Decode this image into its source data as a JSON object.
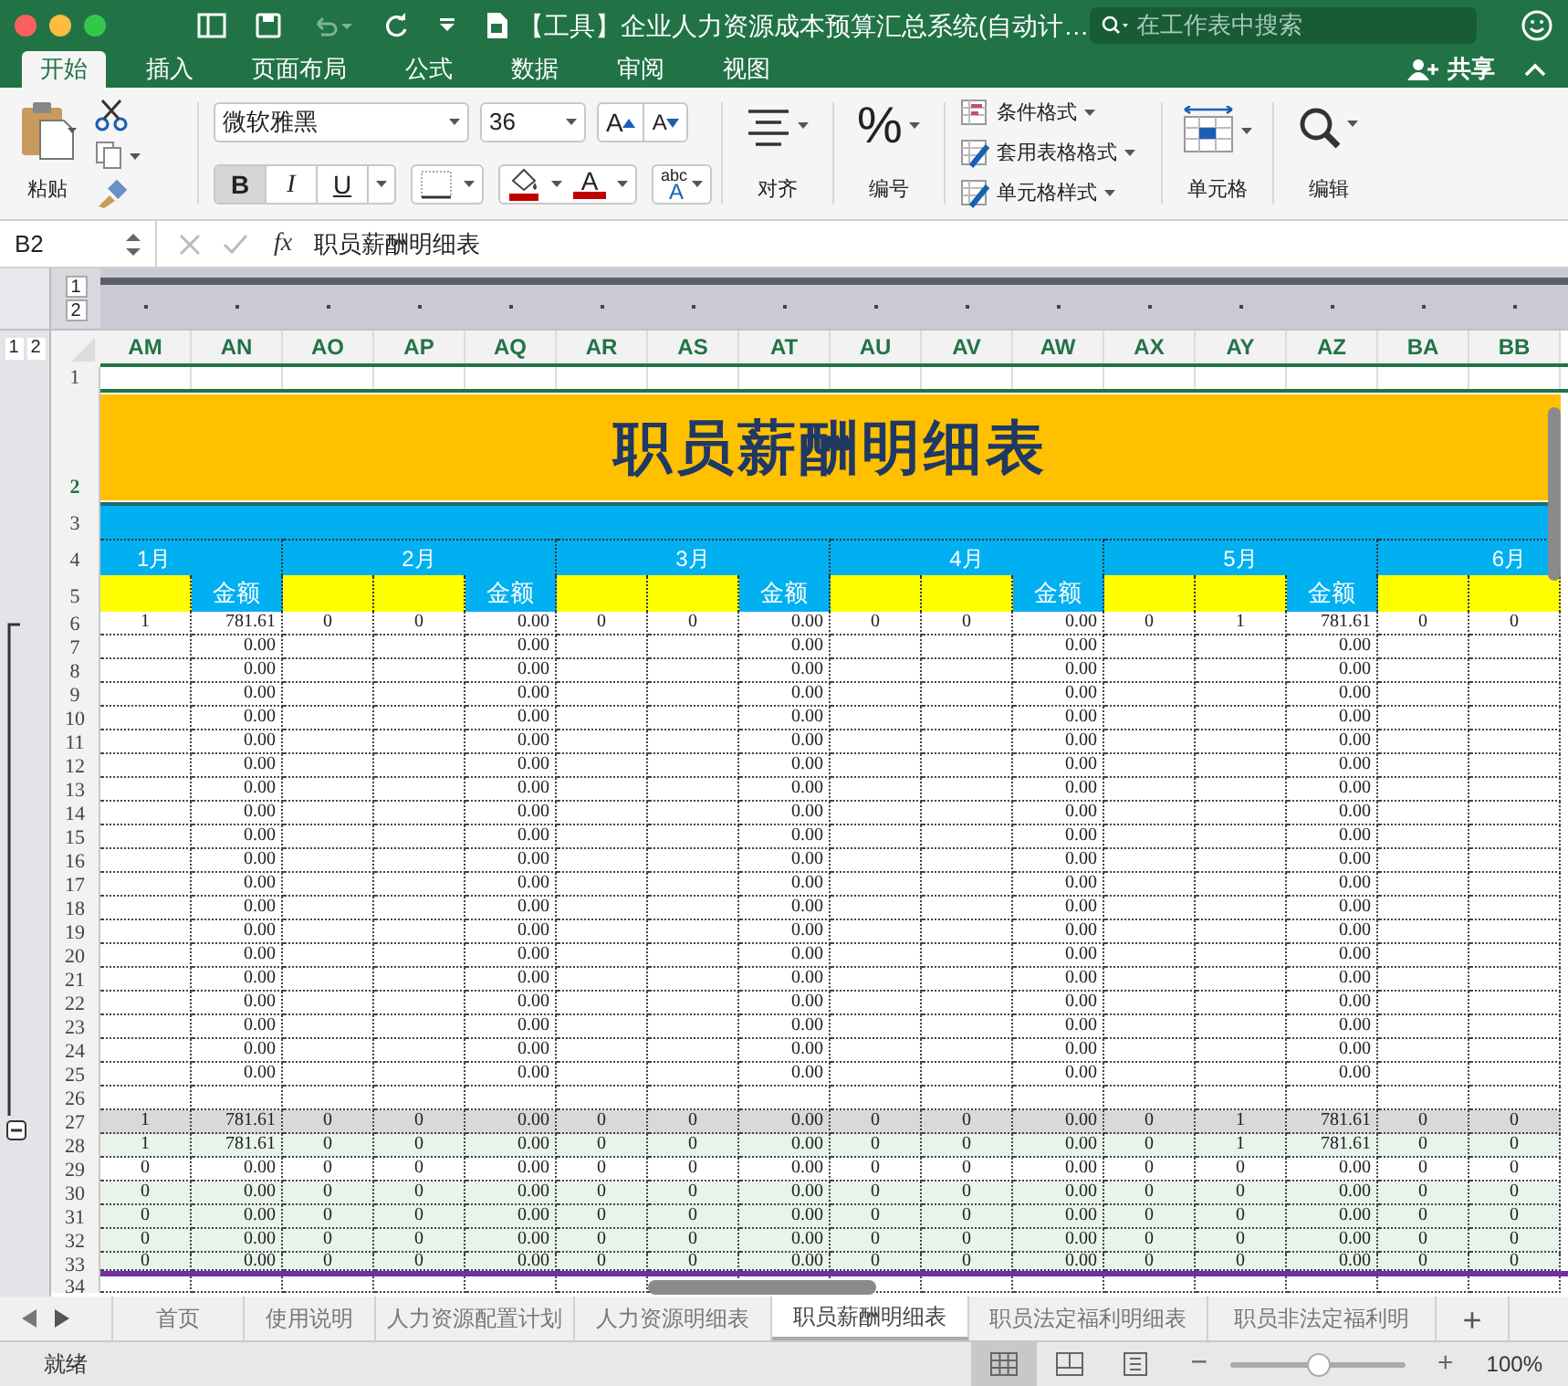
{
  "window": {
    "title": "【工具】企业人力资源成本预算汇总系统(自动计…",
    "search_placeholder": "在工作表中搜索"
  },
  "ribbon_tabs": [
    {
      "label": "开始",
      "selected": true
    },
    {
      "label": "插入",
      "selected": false
    },
    {
      "label": "页面布局",
      "selected": false
    },
    {
      "label": "公式",
      "selected": false
    },
    {
      "label": "数据",
      "selected": false
    },
    {
      "label": "审阅",
      "selected": false
    },
    {
      "label": "视图",
      "selected": false
    }
  ],
  "share": "共享",
  "ribbon": {
    "paste": "粘贴",
    "font_name": "微软雅黑",
    "font_size": "36",
    "grow_font": "A",
    "shrink_font": "A",
    "format_buttons": [
      {
        "label": "B",
        "pressed": true
      },
      {
        "label": "I",
        "pressed": false
      },
      {
        "label": "U",
        "pressed": false
      }
    ],
    "font_color": "A",
    "phonetic": "abc",
    "phonetic_mark": "A",
    "alignment": "对齐",
    "number_symbol": "%",
    "number": "编号",
    "styles": [
      "条件格式",
      "套用表格格式",
      "单元格样式"
    ],
    "cells": "单元格",
    "editing": "编辑"
  },
  "formula_bar": {
    "name_box": "B2",
    "fx": "fx",
    "formula": "职员薪酬明细表"
  },
  "column_outline_levels": [
    "1",
    "2"
  ],
  "row_outline_levels": [
    "1",
    "2"
  ],
  "columns": [
    "AM",
    "AN",
    "AO",
    "AP",
    "AQ",
    "AR",
    "AS",
    "AT",
    "AU",
    "AV",
    "AW",
    "AX",
    "AY",
    "AZ",
    "BA",
    "BB"
  ],
  "title_row": {
    "number": "2",
    "title": "职员薪酬明细表"
  },
  "months": [
    "1月",
    "2月",
    "3月",
    "4月",
    "5月",
    "6月"
  ],
  "subheaders": [
    {
      "kind": "blank"
    },
    {
      "kind": "label",
      "text": "金额"
    },
    {
      "kind": "blank"
    },
    {
      "kind": "blank"
    },
    {
      "kind": "label",
      "text": "金额"
    },
    {
      "kind": "blank"
    },
    {
      "kind": "blank"
    },
    {
      "kind": "label",
      "text": "金额"
    },
    {
      "kind": "blank"
    },
    {
      "kind": "blank"
    },
    {
      "kind": "label",
      "text": "金额"
    },
    {
      "kind": "blank"
    },
    {
      "kind": "blank"
    },
    {
      "kind": "label",
      "text": "金额"
    },
    {
      "kind": "blank"
    },
    {
      "kind": "blank"
    }
  ],
  "rows": [
    {
      "number": "6",
      "kind": "plain",
      "cells": [
        "1",
        "781.61",
        "0",
        "0",
        "0.00",
        "0",
        "0",
        "0.00",
        "0",
        "0",
        "0.00",
        "0",
        "1",
        "781.61",
        "0",
        "0"
      ]
    },
    {
      "number": "7",
      "kind": "plain",
      "cells": [
        null,
        "0.00",
        null,
        null,
        "0.00",
        null,
        null,
        "0.00",
        null,
        null,
        "0.00",
        null,
        null,
        "0.00",
        null,
        null
      ]
    },
    {
      "number": "8",
      "kind": "plain",
      "cells": [
        null,
        "0.00",
        null,
        null,
        "0.00",
        null,
        null,
        "0.00",
        null,
        null,
        "0.00",
        null,
        null,
        "0.00",
        null,
        null
      ]
    },
    {
      "number": "9",
      "kind": "plain",
      "cells": [
        null,
        "0.00",
        null,
        null,
        "0.00",
        null,
        null,
        "0.00",
        null,
        null,
        "0.00",
        null,
        null,
        "0.00",
        null,
        null
      ]
    },
    {
      "number": "10",
      "kind": "plain",
      "cells": [
        null,
        "0.00",
        null,
        null,
        "0.00",
        null,
        null,
        "0.00",
        null,
        null,
        "0.00",
        null,
        null,
        "0.00",
        null,
        null
      ]
    },
    {
      "number": "11",
      "kind": "plain",
      "cells": [
        null,
        "0.00",
        null,
        null,
        "0.00",
        null,
        null,
        "0.00",
        null,
        null,
        "0.00",
        null,
        null,
        "0.00",
        null,
        null
      ]
    },
    {
      "number": "12",
      "kind": "plain",
      "cells": [
        null,
        "0.00",
        null,
        null,
        "0.00",
        null,
        null,
        "0.00",
        null,
        null,
        "0.00",
        null,
        null,
        "0.00",
        null,
        null
      ]
    },
    {
      "number": "13",
      "kind": "plain",
      "cells": [
        null,
        "0.00",
        null,
        null,
        "0.00",
        null,
        null,
        "0.00",
        null,
        null,
        "0.00",
        null,
        null,
        "0.00",
        null,
        null
      ]
    },
    {
      "number": "14",
      "kind": "plain",
      "cells": [
        null,
        "0.00",
        null,
        null,
        "0.00",
        null,
        null,
        "0.00",
        null,
        null,
        "0.00",
        null,
        null,
        "0.00",
        null,
        null
      ]
    },
    {
      "number": "15",
      "kind": "plain",
      "cells": [
        null,
        "0.00",
        null,
        null,
        "0.00",
        null,
        null,
        "0.00",
        null,
        null,
        "0.00",
        null,
        null,
        "0.00",
        null,
        null
      ]
    },
    {
      "number": "16",
      "kind": "plain",
      "cells": [
        null,
        "0.00",
        null,
        null,
        "0.00",
        null,
        null,
        "0.00",
        null,
        null,
        "0.00",
        null,
        null,
        "0.00",
        null,
        null
      ]
    },
    {
      "number": "17",
      "kind": "plain",
      "cells": [
        null,
        "0.00",
        null,
        null,
        "0.00",
        null,
        null,
        "0.00",
        null,
        null,
        "0.00",
        null,
        null,
        "0.00",
        null,
        null
      ]
    },
    {
      "number": "18",
      "kind": "plain",
      "cells": [
        null,
        "0.00",
        null,
        null,
        "0.00",
        null,
        null,
        "0.00",
        null,
        null,
        "0.00",
        null,
        null,
        "0.00",
        null,
        null
      ]
    },
    {
      "number": "19",
      "kind": "plain",
      "cells": [
        null,
        "0.00",
        null,
        null,
        "0.00",
        null,
        null,
        "0.00",
        null,
        null,
        "0.00",
        null,
        null,
        "0.00",
        null,
        null
      ]
    },
    {
      "number": "20",
      "kind": "plain",
      "cells": [
        null,
        "0.00",
        null,
        null,
        "0.00",
        null,
        null,
        "0.00",
        null,
        null,
        "0.00",
        null,
        null,
        "0.00",
        null,
        null
      ]
    },
    {
      "number": "21",
      "kind": "plain",
      "cells": [
        null,
        "0.00",
        null,
        null,
        "0.00",
        null,
        null,
        "0.00",
        null,
        null,
        "0.00",
        null,
        null,
        "0.00",
        null,
        null
      ]
    },
    {
      "number": "22",
      "kind": "plain",
      "cells": [
        null,
        "0.00",
        null,
        null,
        "0.00",
        null,
        null,
        "0.00",
        null,
        null,
        "0.00",
        null,
        null,
        "0.00",
        null,
        null
      ]
    },
    {
      "number": "23",
      "kind": "plain",
      "cells": [
        null,
        "0.00",
        null,
        null,
        "0.00",
        null,
        null,
        "0.00",
        null,
        null,
        "0.00",
        null,
        null,
        "0.00",
        null,
        null
      ]
    },
    {
      "number": "24",
      "kind": "plain",
      "cells": [
        null,
        "0.00",
        null,
        null,
        "0.00",
        null,
        null,
        "0.00",
        null,
        null,
        "0.00",
        null,
        null,
        "0.00",
        null,
        null
      ]
    },
    {
      "number": "25",
      "kind": "plain",
      "cells": [
        null,
        "0.00",
        null,
        null,
        "0.00",
        null,
        null,
        "0.00",
        null,
        null,
        "0.00",
        null,
        null,
        "0.00",
        null,
        null
      ]
    },
    {
      "number": "26",
      "kind": "plain"
    },
    {
      "number": "27",
      "kind": "highlight",
      "cells": [
        "1",
        "781.61",
        "0",
        "0",
        "0.00",
        "0",
        "0",
        "0.00",
        "0",
        "0",
        "0.00",
        "0",
        "1",
        "781.61",
        "0",
        "0"
      ]
    },
    {
      "number": "28",
      "kind": "shaded",
      "cells": [
        "1",
        "781.61",
        "0",
        "0",
        "0.00",
        "0",
        "0",
        "0.00",
        "0",
        "0",
        "0.00",
        "0",
        "1",
        "781.61",
        "0",
        "0"
      ]
    },
    {
      "number": "29",
      "kind": "plain",
      "cells": [
        "0",
        "0.00",
        "0",
        "0",
        "0.00",
        "0",
        "0",
        "0.00",
        "0",
        "0",
        "0.00",
        "0",
        "0",
        "0.00",
        "0",
        "0"
      ]
    },
    {
      "number": "30",
      "kind": "shaded",
      "cells": [
        "0",
        "0.00",
        "0",
        "0",
        "0.00",
        "0",
        "0",
        "0.00",
        "0",
        "0",
        "0.00",
        "0",
        "0",
        "0.00",
        "0",
        "0"
      ]
    },
    {
      "number": "31",
      "kind": "shaded",
      "cells": [
        "0",
        "0.00",
        "0",
        "0",
        "0.00",
        "0",
        "0",
        "0.00",
        "0",
        "0",
        "0.00",
        "0",
        "0",
        "0.00",
        "0",
        "0"
      ]
    },
    {
      "number": "32",
      "kind": "shaded",
      "cells": [
        "0",
        "0.00",
        "0",
        "0",
        "0.00",
        "0",
        "0",
        "0.00",
        "0",
        "0",
        "0.00",
        "0",
        "0",
        "0.00",
        "0",
        "0"
      ]
    },
    {
      "number": "33",
      "kind": "shaded",
      "cells": [
        "0",
        "0.00",
        "0",
        "0",
        "0.00",
        "0",
        "0",
        "0.00",
        "0",
        "0",
        "0.00",
        "0",
        "0",
        "0.00",
        "0",
        "0"
      ]
    },
    {
      "number": "34",
      "kind": "plain"
    }
  ],
  "empty_rows": [
    "1",
    "3",
    "4",
    "5"
  ],
  "sheet_tabs": [
    {
      "label": "首页",
      "selected": false
    },
    {
      "label": "使用说明",
      "selected": false
    },
    {
      "label": "人力资源配置计划",
      "selected": false
    },
    {
      "label": "人力资源明细表",
      "selected": false
    },
    {
      "label": "职员薪酬明细表",
      "selected": true
    },
    {
      "label": "职员法定福利明细表",
      "selected": false
    },
    {
      "label": "职员非法定福利明",
      "selected": false
    }
  ],
  "add_sheet": "+",
  "status_bar": {
    "text": "就绪",
    "views": [
      {
        "kind": "normal",
        "selected": true
      },
      {
        "kind": "layout",
        "selected": false
      },
      {
        "kind": "break",
        "selected": false
      }
    ],
    "zoom_out": "−",
    "zoom_in": "+",
    "level": 0.5,
    "zoom": "100%"
  }
}
